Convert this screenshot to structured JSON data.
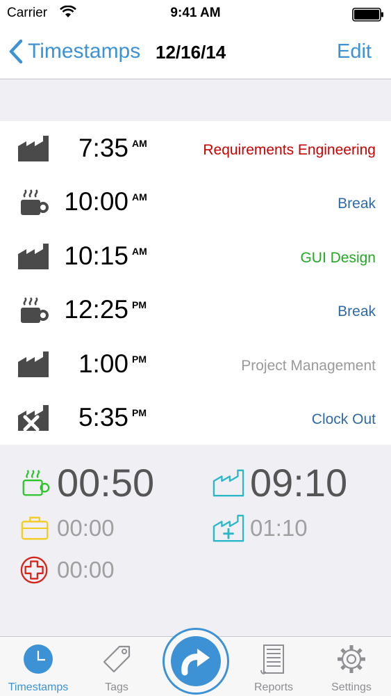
{
  "status_bar": {
    "carrier": "Carrier",
    "time": "9:41 AM"
  },
  "nav": {
    "back_label": "Timestamps",
    "title": "12/16/14",
    "edit_label": "Edit"
  },
  "timestamps": [
    {
      "icon": "factory-icon",
      "time": "7:35",
      "ampm": "AM",
      "tag": "Requirements Engineering",
      "tag_color": "#cc0000"
    },
    {
      "icon": "coffee-cup-icon",
      "time": "10:00",
      "ampm": "AM",
      "tag": "Break",
      "tag_color": "#2e6aa7"
    },
    {
      "icon": "factory-icon",
      "time": "10:15",
      "ampm": "AM",
      "tag": "GUI Design",
      "tag_color": "#22a822"
    },
    {
      "icon": "coffee-cup-icon",
      "time": "12:25",
      "ampm": "PM",
      "tag": "Break",
      "tag_color": "#2e6aa7"
    },
    {
      "icon": "factory-icon",
      "time": "1:00",
      "ampm": "PM",
      "tag": "Project Management",
      "tag_color": "#9a9a9a"
    },
    {
      "icon": "clock-out-icon",
      "time": "5:35",
      "ampm": "PM",
      "tag": "Clock Out",
      "tag_color": "#2e6aa7"
    }
  ],
  "summary": {
    "break": {
      "icon": "coffee-cup-icon",
      "value": "00:50",
      "color": "#2cc52c"
    },
    "work": {
      "icon": "factory-icon",
      "value": "09:10",
      "color": "#2ab8c9"
    },
    "vacation": {
      "icon": "briefcase-icon",
      "value": "00:00",
      "color": "#f2cc1e"
    },
    "overtime": {
      "icon": "factory-plus-icon",
      "value": "01:10",
      "color": "#2ab8c9"
    },
    "sick": {
      "icon": "medical-cross-icon",
      "value": "00:00",
      "color": "#d9241c"
    }
  },
  "tabs": [
    {
      "label": "Timestamps",
      "icon": "clock-icon",
      "active": true
    },
    {
      "label": "Tags",
      "icon": "tag-icon",
      "active": false
    },
    {
      "label": "Reports",
      "icon": "report-icon",
      "active": false
    },
    {
      "label": "Settings",
      "icon": "gear-icon",
      "active": false
    }
  ],
  "center_button": {
    "icon": "redo-arrow-icon"
  },
  "colors": {
    "accent": "#3d92d5",
    "row_icon": "#4a4a4a"
  }
}
